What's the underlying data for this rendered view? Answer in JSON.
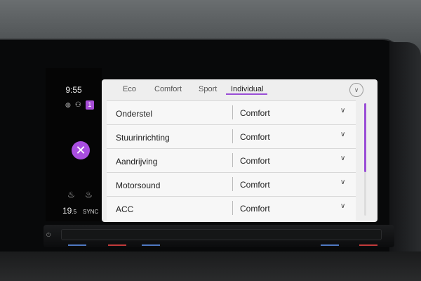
{
  "status": {
    "time": "9:55",
    "profile_number": "1",
    "temperature_main": "19",
    "temperature_decimal": ".5",
    "sync_label": "SYNC"
  },
  "icons": {
    "close": "close-icon",
    "globe": "globe-icon",
    "person": "person-icon",
    "seat_heating": "seat-heating-icon",
    "chevron_down": "chevron-down-icon",
    "power": "power-icon"
  },
  "tabs": [
    {
      "label": "Eco",
      "active": false
    },
    {
      "label": "Comfort",
      "active": false
    },
    {
      "label": "Sport",
      "active": false
    },
    {
      "label": "Individual",
      "active": true
    }
  ],
  "settings": [
    {
      "label": "Onderstel",
      "value": "Comfort"
    },
    {
      "label": "Stuurinrichting",
      "value": "Comfort"
    },
    {
      "label": "Aandrijving",
      "value": "Comfort"
    },
    {
      "label": "Motorsound",
      "value": "Comfort"
    },
    {
      "label": "ACC",
      "value": "Comfort"
    }
  ],
  "colors": {
    "accent": "#9a4ed6",
    "panel_bg": "#eeeeee",
    "led_blue": "#4f78c2",
    "led_red": "#c23a3a"
  }
}
